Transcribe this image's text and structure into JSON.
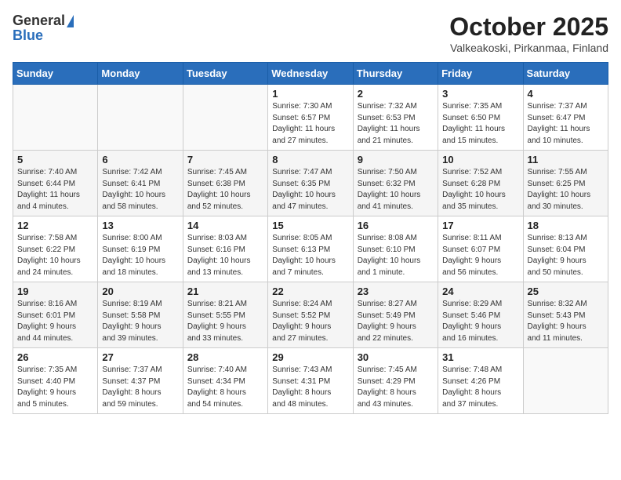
{
  "header": {
    "logo_general": "General",
    "logo_blue": "Blue",
    "title": "October 2025",
    "subtitle": "Valkeakoski, Pirkanmaa, Finland"
  },
  "calendar": {
    "days_of_week": [
      "Sunday",
      "Monday",
      "Tuesday",
      "Wednesday",
      "Thursday",
      "Friday",
      "Saturday"
    ],
    "weeks": [
      [
        {
          "day": "",
          "info": ""
        },
        {
          "day": "",
          "info": ""
        },
        {
          "day": "",
          "info": ""
        },
        {
          "day": "1",
          "info": "Sunrise: 7:30 AM\nSunset: 6:57 PM\nDaylight: 11 hours\nand 27 minutes."
        },
        {
          "day": "2",
          "info": "Sunrise: 7:32 AM\nSunset: 6:53 PM\nDaylight: 11 hours\nand 21 minutes."
        },
        {
          "day": "3",
          "info": "Sunrise: 7:35 AM\nSunset: 6:50 PM\nDaylight: 11 hours\nand 15 minutes."
        },
        {
          "day": "4",
          "info": "Sunrise: 7:37 AM\nSunset: 6:47 PM\nDaylight: 11 hours\nand 10 minutes."
        }
      ],
      [
        {
          "day": "5",
          "info": "Sunrise: 7:40 AM\nSunset: 6:44 PM\nDaylight: 11 hours\nand 4 minutes."
        },
        {
          "day": "6",
          "info": "Sunrise: 7:42 AM\nSunset: 6:41 PM\nDaylight: 10 hours\nand 58 minutes."
        },
        {
          "day": "7",
          "info": "Sunrise: 7:45 AM\nSunset: 6:38 PM\nDaylight: 10 hours\nand 52 minutes."
        },
        {
          "day": "8",
          "info": "Sunrise: 7:47 AM\nSunset: 6:35 PM\nDaylight: 10 hours\nand 47 minutes."
        },
        {
          "day": "9",
          "info": "Sunrise: 7:50 AM\nSunset: 6:32 PM\nDaylight: 10 hours\nand 41 minutes."
        },
        {
          "day": "10",
          "info": "Sunrise: 7:52 AM\nSunset: 6:28 PM\nDaylight: 10 hours\nand 35 minutes."
        },
        {
          "day": "11",
          "info": "Sunrise: 7:55 AM\nSunset: 6:25 PM\nDaylight: 10 hours\nand 30 minutes."
        }
      ],
      [
        {
          "day": "12",
          "info": "Sunrise: 7:58 AM\nSunset: 6:22 PM\nDaylight: 10 hours\nand 24 minutes."
        },
        {
          "day": "13",
          "info": "Sunrise: 8:00 AM\nSunset: 6:19 PM\nDaylight: 10 hours\nand 18 minutes."
        },
        {
          "day": "14",
          "info": "Sunrise: 8:03 AM\nSunset: 6:16 PM\nDaylight: 10 hours\nand 13 minutes."
        },
        {
          "day": "15",
          "info": "Sunrise: 8:05 AM\nSunset: 6:13 PM\nDaylight: 10 hours\nand 7 minutes."
        },
        {
          "day": "16",
          "info": "Sunrise: 8:08 AM\nSunset: 6:10 PM\nDaylight: 10 hours\nand 1 minute."
        },
        {
          "day": "17",
          "info": "Sunrise: 8:11 AM\nSunset: 6:07 PM\nDaylight: 9 hours\nand 56 minutes."
        },
        {
          "day": "18",
          "info": "Sunrise: 8:13 AM\nSunset: 6:04 PM\nDaylight: 9 hours\nand 50 minutes."
        }
      ],
      [
        {
          "day": "19",
          "info": "Sunrise: 8:16 AM\nSunset: 6:01 PM\nDaylight: 9 hours\nand 44 minutes."
        },
        {
          "day": "20",
          "info": "Sunrise: 8:19 AM\nSunset: 5:58 PM\nDaylight: 9 hours\nand 39 minutes."
        },
        {
          "day": "21",
          "info": "Sunrise: 8:21 AM\nSunset: 5:55 PM\nDaylight: 9 hours\nand 33 minutes."
        },
        {
          "day": "22",
          "info": "Sunrise: 8:24 AM\nSunset: 5:52 PM\nDaylight: 9 hours\nand 27 minutes."
        },
        {
          "day": "23",
          "info": "Sunrise: 8:27 AM\nSunset: 5:49 PM\nDaylight: 9 hours\nand 22 minutes."
        },
        {
          "day": "24",
          "info": "Sunrise: 8:29 AM\nSunset: 5:46 PM\nDaylight: 9 hours\nand 16 minutes."
        },
        {
          "day": "25",
          "info": "Sunrise: 8:32 AM\nSunset: 5:43 PM\nDaylight: 9 hours\nand 11 minutes."
        }
      ],
      [
        {
          "day": "26",
          "info": "Sunrise: 7:35 AM\nSunset: 4:40 PM\nDaylight: 9 hours\nand 5 minutes."
        },
        {
          "day": "27",
          "info": "Sunrise: 7:37 AM\nSunset: 4:37 PM\nDaylight: 8 hours\nand 59 minutes."
        },
        {
          "day": "28",
          "info": "Sunrise: 7:40 AM\nSunset: 4:34 PM\nDaylight: 8 hours\nand 54 minutes."
        },
        {
          "day": "29",
          "info": "Sunrise: 7:43 AM\nSunset: 4:31 PM\nDaylight: 8 hours\nand 48 minutes."
        },
        {
          "day": "30",
          "info": "Sunrise: 7:45 AM\nSunset: 4:29 PM\nDaylight: 8 hours\nand 43 minutes."
        },
        {
          "day": "31",
          "info": "Sunrise: 7:48 AM\nSunset: 4:26 PM\nDaylight: 8 hours\nand 37 minutes."
        },
        {
          "day": "",
          "info": ""
        }
      ]
    ]
  }
}
